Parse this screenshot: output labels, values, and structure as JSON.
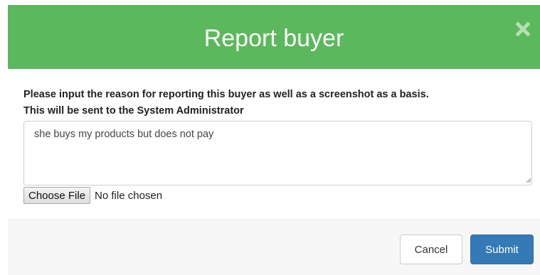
{
  "dialog": {
    "title": "Report buyer",
    "close_icon": "close-icon",
    "header_color": "#5cb85c"
  },
  "body": {
    "instruction_line1": "Please input the reason for reporting this buyer as well as a screenshot as a basis.",
    "instruction_line2": "This will be sent to the System Administrator",
    "reason_value": "she buys my products but does not pay",
    "file_button_label": "Choose File",
    "file_status": "No file chosen"
  },
  "footer": {
    "cancel_label": "Cancel",
    "submit_label": "Submit",
    "submit_color": "#337ab7"
  }
}
